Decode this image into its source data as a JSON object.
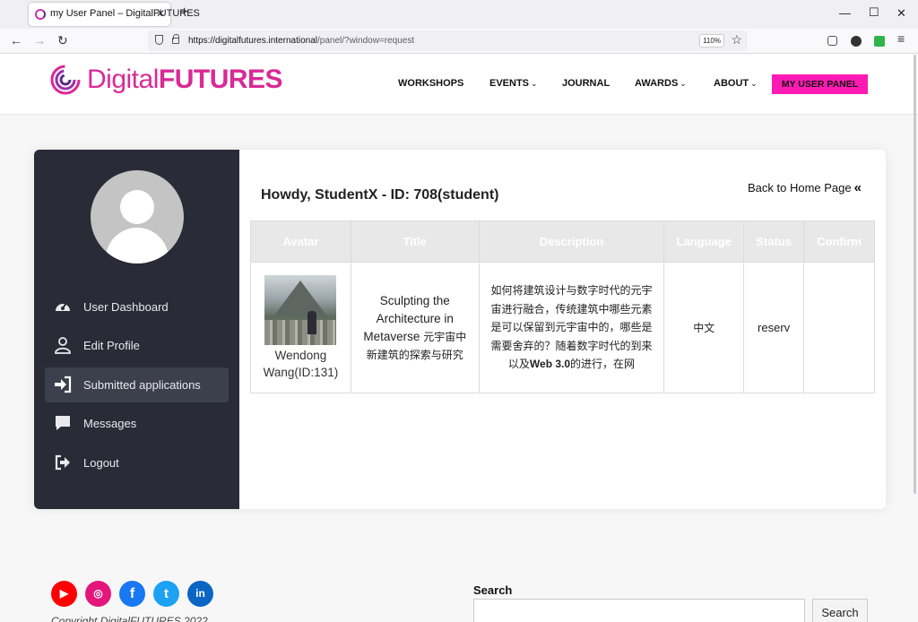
{
  "browser": {
    "tab_title": "my User Panel – DigitalFUTURES",
    "url_host": "https://digitalfutures.international",
    "url_path": "/panel/?window=request",
    "zoom": "110%"
  },
  "site": {
    "logo_regular": "Digital",
    "logo_bold": "FUTURES",
    "nav": [
      {
        "label": "WORKSHOPS",
        "dropdown": false
      },
      {
        "label": "EVENTS",
        "dropdown": true
      },
      {
        "label": "JOURNAL",
        "dropdown": false
      },
      {
        "label": "AWARDS",
        "dropdown": true
      },
      {
        "label": "ABOUT",
        "dropdown": true
      }
    ],
    "panel_button": "MY USER PANEL",
    "accent_color": "#ff1ab3"
  },
  "sidebar": {
    "items": [
      {
        "label": "User Dashboard",
        "icon": "dashboard-icon",
        "active": false
      },
      {
        "label": "Edit Profile",
        "icon": "user-icon",
        "active": false
      },
      {
        "label": "Submitted applications",
        "icon": "sign-in-icon",
        "active": true
      },
      {
        "label": "Messages",
        "icon": "message-icon",
        "active": false
      },
      {
        "label": "Logout",
        "icon": "logout-icon",
        "active": false
      }
    ]
  },
  "main": {
    "greeting": "Howdy, StudentX - ID: 708(student)",
    "back_link": "Back to Home Page",
    "table": {
      "headers": [
        "Avatar",
        "Title",
        "Description",
        "Language",
        "Status",
        "Confirm"
      ],
      "rows": [
        {
          "author": "Wendong Wang(ID:131)",
          "title_en": "Sculpting the Architecture in Metaverse",
          "title_zh": "元宇宙中新建筑的探索与研究",
          "description_pre": "如何将建筑设计与数字时代的元宇宙进行融合，传统建筑中哪些元素是可以保留到元宇宙中的，哪些是需要舍弃的？随着数字时代的到来以及",
          "description_bold": "Web 3.0",
          "description_post": "的进行，在网",
          "language": "中文",
          "status": "reserv",
          "confirm": ""
        }
      ]
    }
  },
  "footer": {
    "social": [
      {
        "name": "youtube",
        "color": "#ff0000",
        "glyph": "▶"
      },
      {
        "name": "instagram",
        "color": "#e4157b",
        "glyph": "◎"
      },
      {
        "name": "facebook",
        "color": "#1877f2",
        "glyph": "f"
      },
      {
        "name": "twitter",
        "color": "#1da1f2",
        "glyph": "t"
      },
      {
        "name": "linkedin",
        "color": "#0a66c2",
        "glyph": "in"
      }
    ],
    "copyright": "Copyright DigitalFUTURES 2022",
    "search_label": "Search",
    "search_button": "Search"
  }
}
